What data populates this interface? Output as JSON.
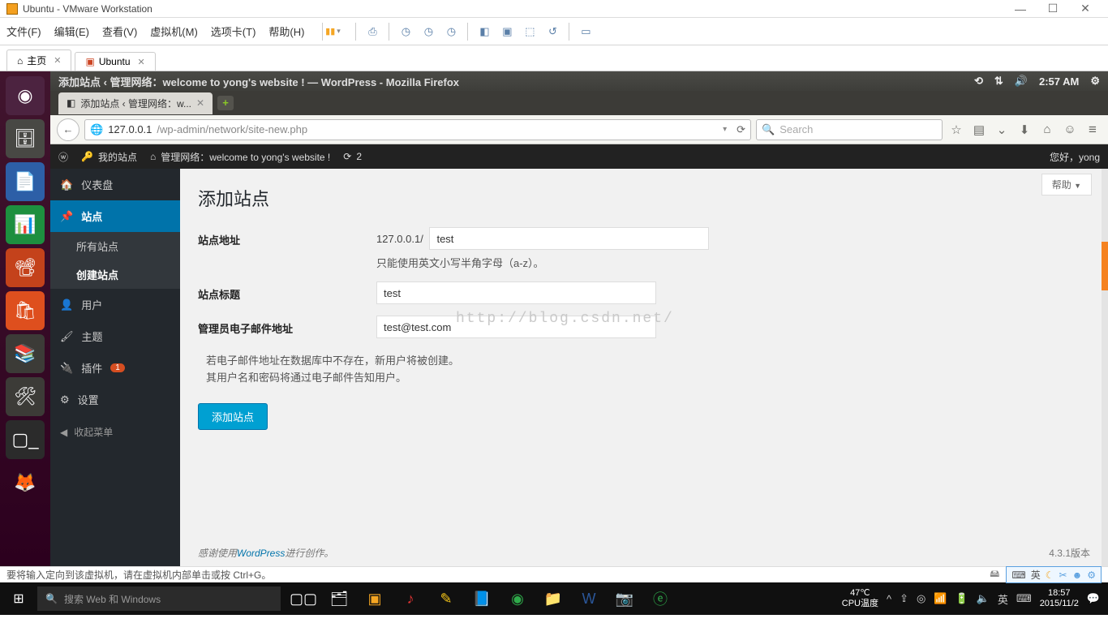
{
  "vmware": {
    "title": "Ubuntu - VMware Workstation",
    "menu": [
      "文件(F)",
      "编辑(E)",
      "查看(V)",
      "虚拟机(M)",
      "选项卡(T)",
      "帮助(H)"
    ],
    "tabs": {
      "home": "主页",
      "vm": "Ubuntu"
    },
    "status": "要将输入定向到该虚拟机，请在虚拟机内部单击或按 Ctrl+G。",
    "ime": "英"
  },
  "firefox": {
    "title": "添加站点 ‹ 管理网络：welcome to yong's website ! — WordPress - Mozilla Firefox",
    "clock": "2:57 AM",
    "tab": "添加站点 ‹ 管理网络：w...",
    "url_domain": "127.0.0.1",
    "url_path": "/wp-admin/network/site-new.php",
    "search_placeholder": "Search"
  },
  "wpbar": {
    "mysites": "我的站点",
    "network": "管理网络：welcome to yong's website !",
    "count": "2",
    "greeting": "您好，yong"
  },
  "sidebar": {
    "dashboard": "仪表盘",
    "sites": "站点",
    "sites_all": "所有站点",
    "sites_new": "创建站点",
    "users": "用户",
    "themes": "主题",
    "plugins": "插件",
    "plugins_badge": "1",
    "settings": "设置",
    "collapse": "收起菜单"
  },
  "page": {
    "help": "帮助",
    "title": "添加站点",
    "addr_label": "站点地址",
    "addr_prefix": "127.0.0.1/",
    "addr_value": "test",
    "addr_hint": "只能使用英文小写半角字母（a-z）。",
    "title_label": "站点标题",
    "title_value": "test",
    "email_label": "管理员电子邮件地址",
    "email_value": "test@test.com",
    "note1": "若电子邮件地址在数据库中不存在，新用户将被创建。",
    "note2": "其用户名和密码将通过电子邮件告知用户。",
    "submit": "添加站点",
    "footer_pre": "感谢使用",
    "footer_link": "WordPress",
    "footer_post": "进行创作。",
    "version": "4.3.1版本",
    "watermark": "http://blog.csdn.net/"
  },
  "win": {
    "search": "搜索 Web 和 Windows",
    "temp": "47℃",
    "temp_lbl": "CPU温度",
    "time": "18:57",
    "date": "2015/11/2",
    "ime": "英"
  }
}
